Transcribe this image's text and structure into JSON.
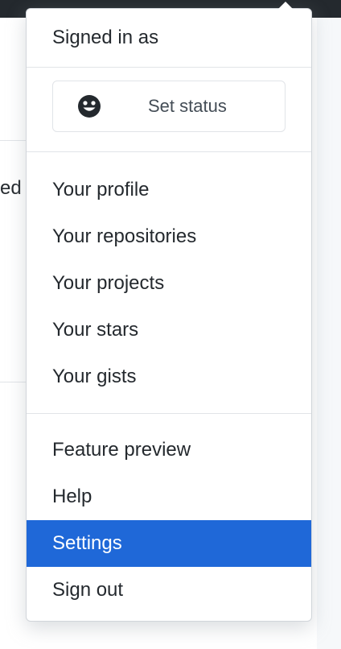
{
  "header": {
    "signed_in_label": "Signed in as"
  },
  "status": {
    "icon": "smiley-icon",
    "label": "Set status"
  },
  "page": {
    "clipped_text": "ed"
  },
  "menu": {
    "group1": [
      {
        "label": "Your profile"
      },
      {
        "label": "Your repositories"
      },
      {
        "label": "Your projects"
      },
      {
        "label": "Your stars"
      },
      {
        "label": "Your gists"
      }
    ],
    "group2": [
      {
        "label": "Feature preview"
      },
      {
        "label": "Help"
      },
      {
        "label": "Settings",
        "active": true
      },
      {
        "label": "Sign out"
      }
    ]
  },
  "colors": {
    "header": "#24292e",
    "active": "#1f68d8",
    "text": "#24292e"
  }
}
